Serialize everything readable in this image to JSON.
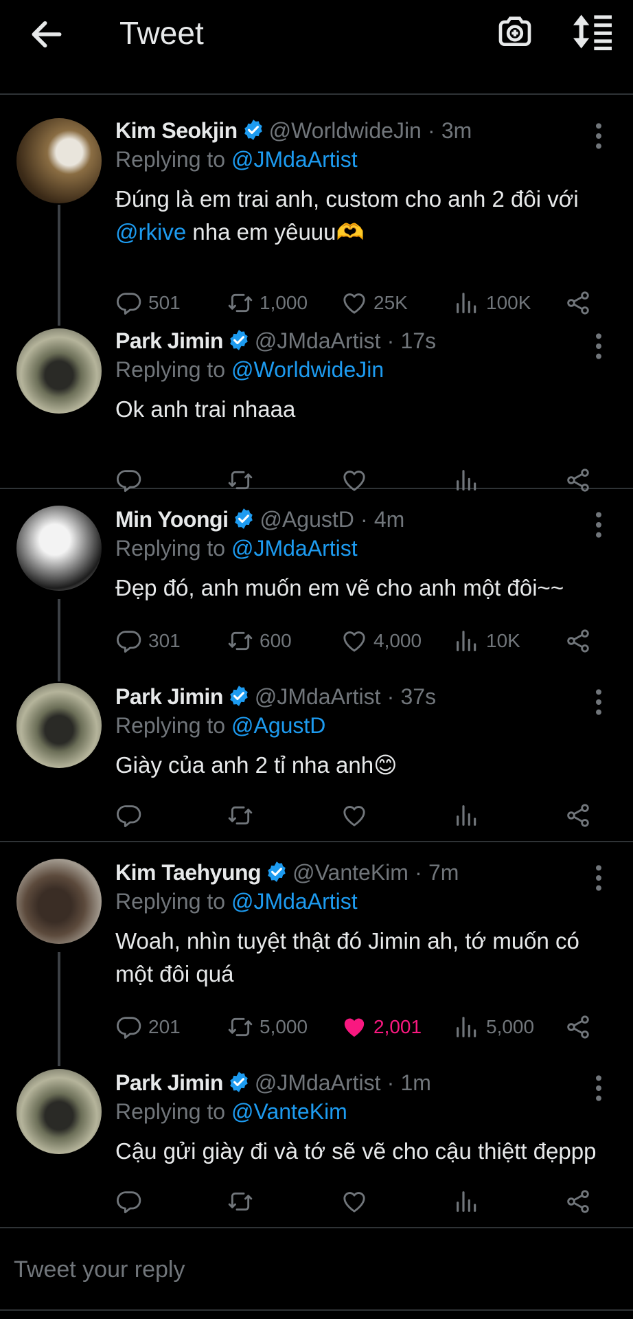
{
  "colors": {
    "accent": "#1d9bf0",
    "like": "#f91880",
    "muted": "#71767b",
    "background": "#000000"
  },
  "header": {
    "title": "Tweet",
    "back_icon": "arrow-left-icon",
    "camera_icon": "camera-add-icon",
    "sort_icon": "sort-icon"
  },
  "threads": [
    {
      "parent": {
        "name": "Kim Seokjin",
        "handle": "@WorldwideJin",
        "dot": "·",
        "time": "3m",
        "replying_prefix": "Replying to",
        "replying_to": "@JMdaArtist",
        "text_1": "Đúng là em trai anh, custom cho anh 2 đôi với",
        "text_mention": "@rkive",
        "text_2": "nha em yêuuu🫶",
        "replies": "501",
        "retweets": "1,000",
        "likes": "25K",
        "views": "100K"
      },
      "reply": {
        "name": "Park Jimin",
        "handle": "@JMdaArtist",
        "dot": "·",
        "time": "17s",
        "replying_prefix": "Replying to",
        "replying_to": "@WorldwideJin",
        "text": "Ok anh trai nhaaa"
      }
    },
    {
      "parent": {
        "name": "Min Yoongi",
        "handle": "@AgustD",
        "dot": "·",
        "time": "4m",
        "replying_prefix": "Replying to",
        "replying_to": "@JMdaArtist",
        "text": "Đẹp đó, anh muốn em  vẽ cho anh một đôi~~",
        "replies": "301",
        "retweets": "600",
        "likes": "4,000",
        "views": "10K"
      },
      "reply": {
        "name": "Park Jimin",
        "handle": "@JMdaArtist",
        "dot": "·",
        "time": "37s",
        "replying_prefix": "Replying to",
        "replying_to": "@AgustD",
        "text": "Giày của anh 2 tỉ nha anh😊"
      }
    },
    {
      "parent": {
        "name": "Kim Taehyung",
        "handle": "@VanteKim",
        "dot": "·",
        "time": "7m",
        "replying_prefix": "Replying to",
        "replying_to": "@JMdaArtist",
        "text": "Woah, nhìn tuyệt thật đó Jimin ah, tớ muốn có một đôi quá",
        "replies": "201",
        "retweets": "5,000",
        "likes": "2,001",
        "views": "5,000",
        "liked": true
      },
      "reply": {
        "name": "Park Jimin",
        "handle": "@JMdaArtist",
        "dot": "·",
        "time": "1m",
        "replying_prefix": "Replying to",
        "replying_to": "@VanteKim",
        "text": "Cậu gửi giày đi và tớ sẽ vẽ cho cậu thiệtt đẹppp"
      }
    }
  ],
  "composer": {
    "placeholder": "Tweet your reply"
  }
}
